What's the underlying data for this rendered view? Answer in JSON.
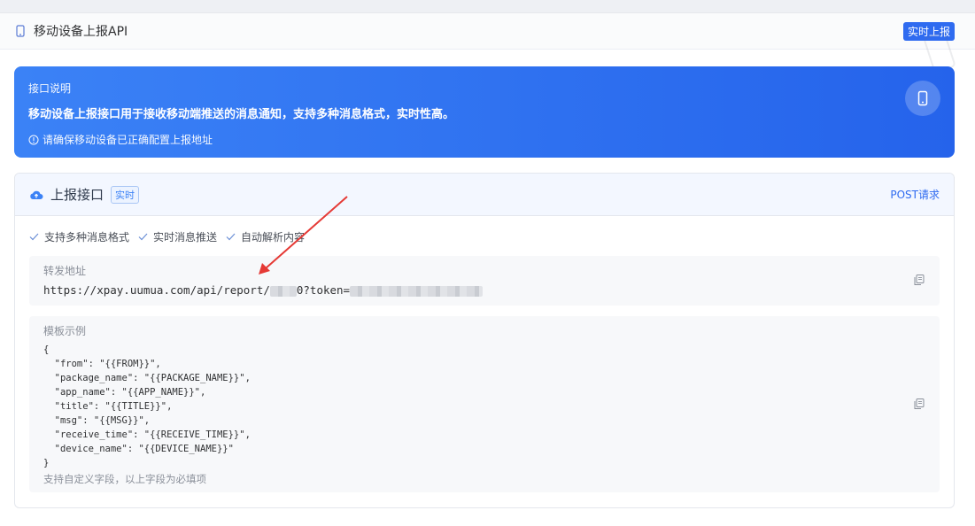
{
  "header": {
    "title": "移动设备上报API",
    "badge": "实时上报"
  },
  "banner": {
    "label": "接口说明",
    "description": "移动设备上报接口用于接收移动端推送的消息通知，支持多种消息格式，实时性高。",
    "tip": "请确保移动设备已正确配置上报地址"
  },
  "card": {
    "title": "上报接口",
    "tag": "实时",
    "method": "POST请求",
    "features": [
      "支持多种消息格式",
      "实时消息推送",
      "自动解析内容"
    ],
    "forward": {
      "label": "转发地址",
      "url_prefix": "https://xpay.uumua.com/api/report/",
      "url_mid": "0?token="
    },
    "template": {
      "label": "模板示例",
      "code": "{\n  \"from\": \"{{FROM}}\",\n  \"package_name\": \"{{PACKAGE_NAME}}\",\n  \"app_name\": \"{{APP_NAME}}\",\n  \"title\": \"{{TITLE}}\",\n  \"msg\": \"{{MSG}}\",\n  \"receive_time\": \"{{RECEIVE_TIME}}\",\n  \"device_name\": \"{{DEVICE_NAME}}\"\n}",
      "note": "支持自定义字段，以上字段为必填项"
    }
  },
  "colors": {
    "accent": "#2f6bf0",
    "banner_start": "#3b82f6",
    "banner_end": "#2563eb",
    "annotation_arrow": "#e53935"
  }
}
